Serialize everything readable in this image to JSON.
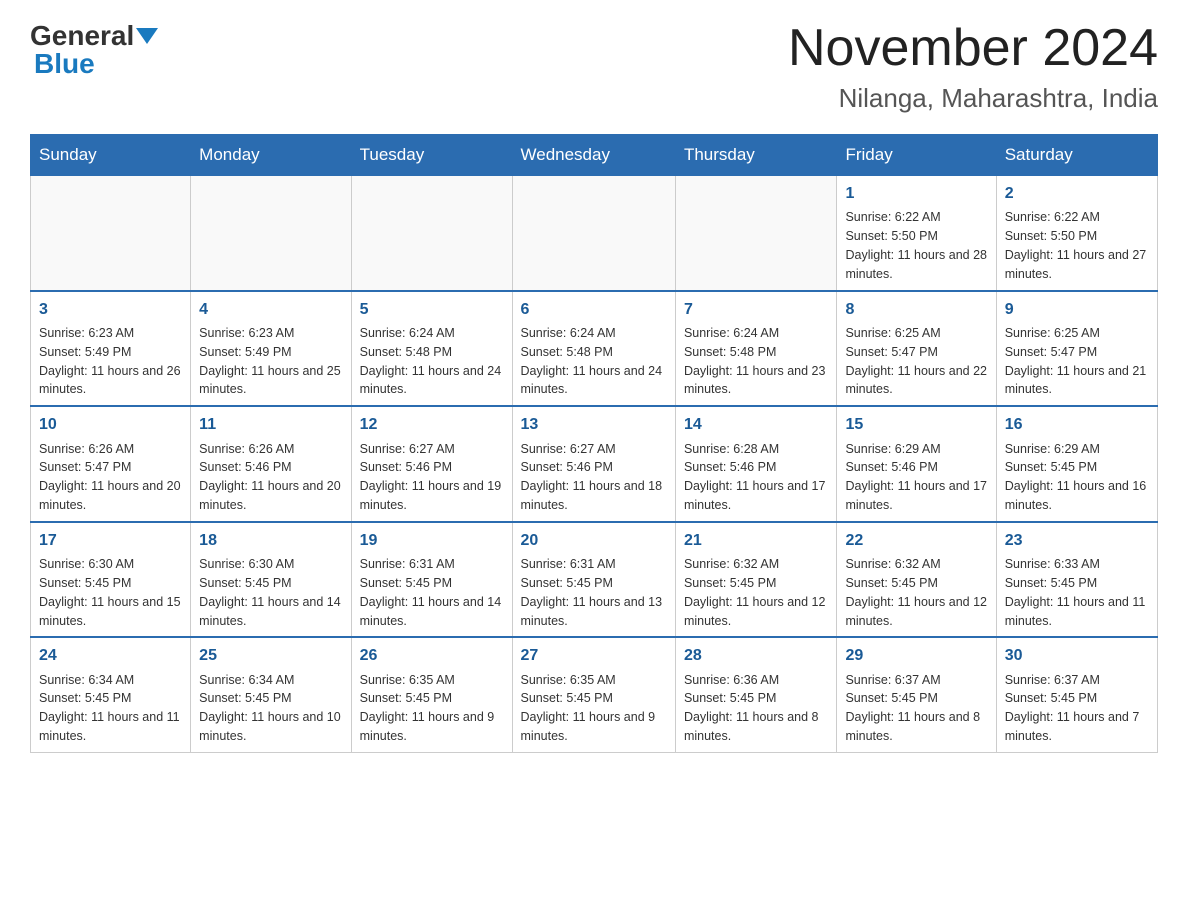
{
  "header": {
    "logo_general": "General",
    "logo_blue": "Blue",
    "title": "November 2024",
    "subtitle": "Nilanga, Maharashtra, India"
  },
  "days_of_week": [
    "Sunday",
    "Monday",
    "Tuesday",
    "Wednesday",
    "Thursday",
    "Friday",
    "Saturday"
  ],
  "weeks": [
    [
      {
        "day": "",
        "sunrise": "",
        "sunset": "",
        "daylight": ""
      },
      {
        "day": "",
        "sunrise": "",
        "sunset": "",
        "daylight": ""
      },
      {
        "day": "",
        "sunrise": "",
        "sunset": "",
        "daylight": ""
      },
      {
        "day": "",
        "sunrise": "",
        "sunset": "",
        "daylight": ""
      },
      {
        "day": "",
        "sunrise": "",
        "sunset": "",
        "daylight": ""
      },
      {
        "day": "1",
        "sunrise": "Sunrise: 6:22 AM",
        "sunset": "Sunset: 5:50 PM",
        "daylight": "Daylight: 11 hours and 28 minutes."
      },
      {
        "day": "2",
        "sunrise": "Sunrise: 6:22 AM",
        "sunset": "Sunset: 5:50 PM",
        "daylight": "Daylight: 11 hours and 27 minutes."
      }
    ],
    [
      {
        "day": "3",
        "sunrise": "Sunrise: 6:23 AM",
        "sunset": "Sunset: 5:49 PM",
        "daylight": "Daylight: 11 hours and 26 minutes."
      },
      {
        "day": "4",
        "sunrise": "Sunrise: 6:23 AM",
        "sunset": "Sunset: 5:49 PM",
        "daylight": "Daylight: 11 hours and 25 minutes."
      },
      {
        "day": "5",
        "sunrise": "Sunrise: 6:24 AM",
        "sunset": "Sunset: 5:48 PM",
        "daylight": "Daylight: 11 hours and 24 minutes."
      },
      {
        "day": "6",
        "sunrise": "Sunrise: 6:24 AM",
        "sunset": "Sunset: 5:48 PM",
        "daylight": "Daylight: 11 hours and 24 minutes."
      },
      {
        "day": "7",
        "sunrise": "Sunrise: 6:24 AM",
        "sunset": "Sunset: 5:48 PM",
        "daylight": "Daylight: 11 hours and 23 minutes."
      },
      {
        "day": "8",
        "sunrise": "Sunrise: 6:25 AM",
        "sunset": "Sunset: 5:47 PM",
        "daylight": "Daylight: 11 hours and 22 minutes."
      },
      {
        "day": "9",
        "sunrise": "Sunrise: 6:25 AM",
        "sunset": "Sunset: 5:47 PM",
        "daylight": "Daylight: 11 hours and 21 minutes."
      }
    ],
    [
      {
        "day": "10",
        "sunrise": "Sunrise: 6:26 AM",
        "sunset": "Sunset: 5:47 PM",
        "daylight": "Daylight: 11 hours and 20 minutes."
      },
      {
        "day": "11",
        "sunrise": "Sunrise: 6:26 AM",
        "sunset": "Sunset: 5:46 PM",
        "daylight": "Daylight: 11 hours and 20 minutes."
      },
      {
        "day": "12",
        "sunrise": "Sunrise: 6:27 AM",
        "sunset": "Sunset: 5:46 PM",
        "daylight": "Daylight: 11 hours and 19 minutes."
      },
      {
        "day": "13",
        "sunrise": "Sunrise: 6:27 AM",
        "sunset": "Sunset: 5:46 PM",
        "daylight": "Daylight: 11 hours and 18 minutes."
      },
      {
        "day": "14",
        "sunrise": "Sunrise: 6:28 AM",
        "sunset": "Sunset: 5:46 PM",
        "daylight": "Daylight: 11 hours and 17 minutes."
      },
      {
        "day": "15",
        "sunrise": "Sunrise: 6:29 AM",
        "sunset": "Sunset: 5:46 PM",
        "daylight": "Daylight: 11 hours and 17 minutes."
      },
      {
        "day": "16",
        "sunrise": "Sunrise: 6:29 AM",
        "sunset": "Sunset: 5:45 PM",
        "daylight": "Daylight: 11 hours and 16 minutes."
      }
    ],
    [
      {
        "day": "17",
        "sunrise": "Sunrise: 6:30 AM",
        "sunset": "Sunset: 5:45 PM",
        "daylight": "Daylight: 11 hours and 15 minutes."
      },
      {
        "day": "18",
        "sunrise": "Sunrise: 6:30 AM",
        "sunset": "Sunset: 5:45 PM",
        "daylight": "Daylight: 11 hours and 14 minutes."
      },
      {
        "day": "19",
        "sunrise": "Sunrise: 6:31 AM",
        "sunset": "Sunset: 5:45 PM",
        "daylight": "Daylight: 11 hours and 14 minutes."
      },
      {
        "day": "20",
        "sunrise": "Sunrise: 6:31 AM",
        "sunset": "Sunset: 5:45 PM",
        "daylight": "Daylight: 11 hours and 13 minutes."
      },
      {
        "day": "21",
        "sunrise": "Sunrise: 6:32 AM",
        "sunset": "Sunset: 5:45 PM",
        "daylight": "Daylight: 11 hours and 12 minutes."
      },
      {
        "day": "22",
        "sunrise": "Sunrise: 6:32 AM",
        "sunset": "Sunset: 5:45 PM",
        "daylight": "Daylight: 11 hours and 12 minutes."
      },
      {
        "day": "23",
        "sunrise": "Sunrise: 6:33 AM",
        "sunset": "Sunset: 5:45 PM",
        "daylight": "Daylight: 11 hours and 11 minutes."
      }
    ],
    [
      {
        "day": "24",
        "sunrise": "Sunrise: 6:34 AM",
        "sunset": "Sunset: 5:45 PM",
        "daylight": "Daylight: 11 hours and 11 minutes."
      },
      {
        "day": "25",
        "sunrise": "Sunrise: 6:34 AM",
        "sunset": "Sunset: 5:45 PM",
        "daylight": "Daylight: 11 hours and 10 minutes."
      },
      {
        "day": "26",
        "sunrise": "Sunrise: 6:35 AM",
        "sunset": "Sunset: 5:45 PM",
        "daylight": "Daylight: 11 hours and 9 minutes."
      },
      {
        "day": "27",
        "sunrise": "Sunrise: 6:35 AM",
        "sunset": "Sunset: 5:45 PM",
        "daylight": "Daylight: 11 hours and 9 minutes."
      },
      {
        "day": "28",
        "sunrise": "Sunrise: 6:36 AM",
        "sunset": "Sunset: 5:45 PM",
        "daylight": "Daylight: 11 hours and 8 minutes."
      },
      {
        "day": "29",
        "sunrise": "Sunrise: 6:37 AM",
        "sunset": "Sunset: 5:45 PM",
        "daylight": "Daylight: 11 hours and 8 minutes."
      },
      {
        "day": "30",
        "sunrise": "Sunrise: 6:37 AM",
        "sunset": "Sunset: 5:45 PM",
        "daylight": "Daylight: 11 hours and 7 minutes."
      }
    ]
  ]
}
